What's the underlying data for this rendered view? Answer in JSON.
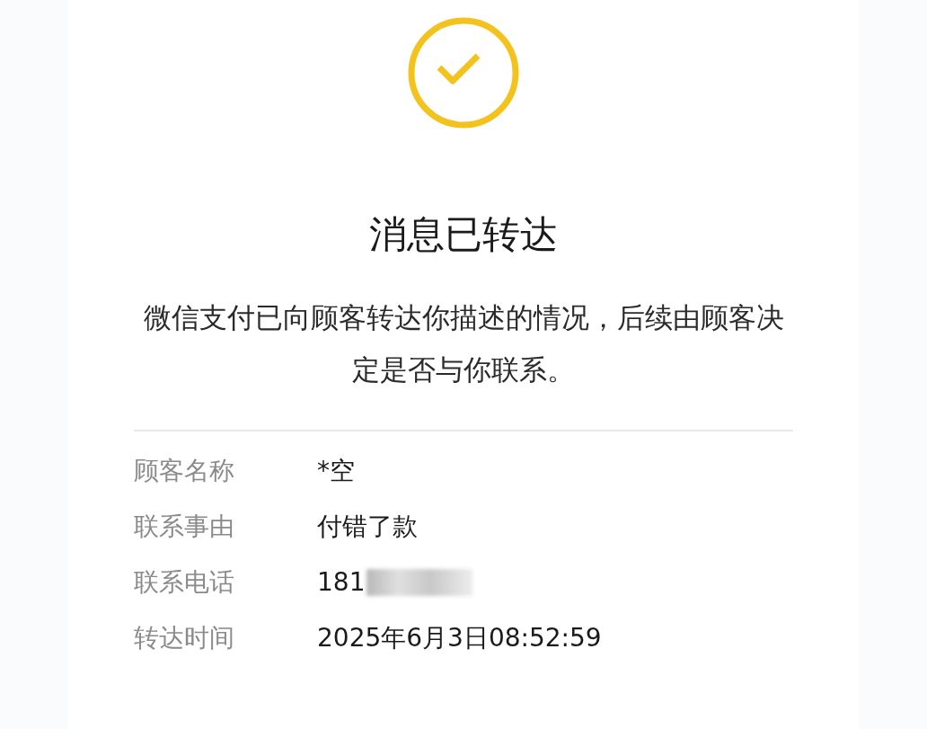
{
  "title": "消息已转达",
  "description": "微信支付已向顾客转达你描述的情况，后续由顾客决定是否与你联系。",
  "details": [
    {
      "label": "顾客名称",
      "value": "*空"
    },
    {
      "label": "联系事由",
      "value": "付错了款"
    },
    {
      "label": "联系电话",
      "value": "181",
      "redacted": true
    },
    {
      "label": "转达时间",
      "value": "2025年6月3日08:52:59"
    }
  ]
}
